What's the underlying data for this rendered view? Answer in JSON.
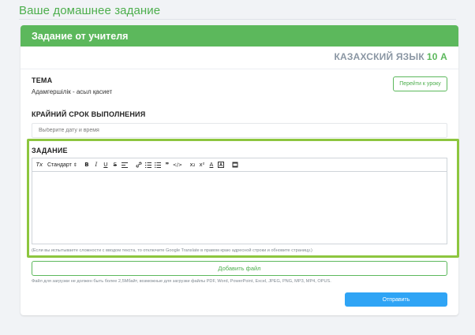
{
  "page": {
    "title": "Ваше домашнее задание"
  },
  "card": {
    "header": "Задание от учителя",
    "subject": "КАЗАХСКИЙ ЯЗЫК",
    "grade": "10 А"
  },
  "topic": {
    "label": "ТЕМА",
    "value": "Адамгершілік - асыл қасиет",
    "goto_lesson_label": "Перейти к уроку"
  },
  "deadline": {
    "label": "КРАЙНИЙ СРОК ВЫПОЛНЕНИЯ",
    "placeholder": "Выберите дату и время"
  },
  "assignment": {
    "label": "ЗАДАНИЕ",
    "toolbar": {
      "clear_format": "Tx",
      "heading_select": "Стандарт",
      "bold": "B",
      "italic": "I",
      "underline": "U",
      "strike": "S",
      "superscript": "x²",
      "subscript": "x₂",
      "font_color": "A"
    },
    "hint": "(Если вы испытываете сложности с вводом текста, то отключите Google Translate в правом краю адресной строки и обновите страницу.)"
  },
  "upload": {
    "add_file_label": "Добавить файл",
    "limits": "Файл для загрузки не должен быть более 2,5Мбайт, возможные для загрузки файлы PDF, Word, PowerPoint, Excel, JPEG, PNG, MP3, MP4, OPUS."
  },
  "submit_label": "Отправить",
  "colors": {
    "accent_green": "#5cb85c",
    "highlight_border": "#8dc63f",
    "submit_blue": "#2fa4f5"
  }
}
